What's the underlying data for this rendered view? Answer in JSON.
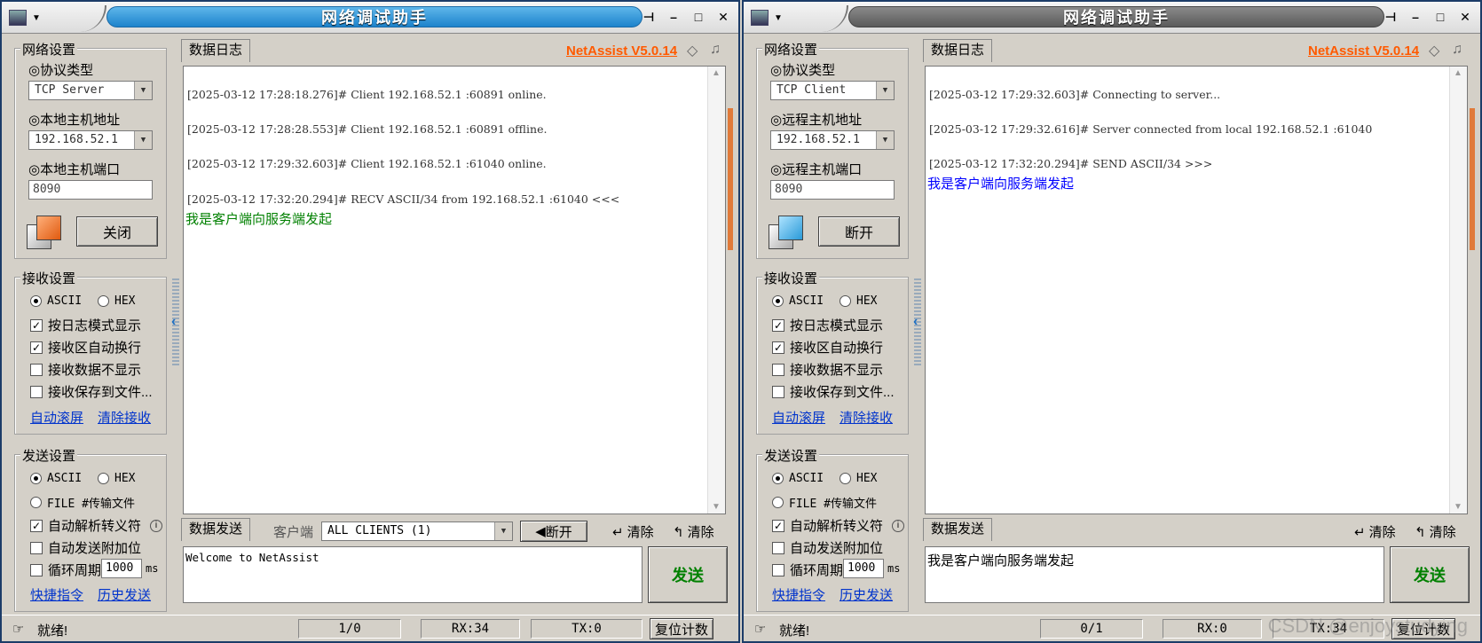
{
  "colors": {
    "active_title": "#1d83cc",
    "inactive_title": "#5a5a5a",
    "brand": "#ff5a00",
    "recv_text": "#008000",
    "send_text": "#0000ff",
    "link": "#0033cc"
  },
  "left": {
    "title": "网络调试助手",
    "network": {
      "group_title": "网络设置",
      "protocol_label": "◎协议类型",
      "protocol_value": "TCP Server",
      "host_label": "◎本地主机地址",
      "host_value": "192.168.52.1",
      "port_label": "◎本地主机端口",
      "port_value": "8090",
      "action_button": "关闭"
    },
    "recv": {
      "group_title": "接收设置",
      "ascii": "ASCII",
      "hex": "HEX",
      "opt_log_mode": "按日志模式显示",
      "opt_auto_wrap": "接收区自动换行",
      "opt_hide_data": "接收数据不显示",
      "opt_save_file": "接收保存到文件...",
      "link_autoscroll": "自动滚屏",
      "link_clear": "清除接收"
    },
    "send": {
      "group_title": "发送设置",
      "ascii": "ASCII",
      "hex": "HEX",
      "file_mode": "FILE #传输文件",
      "opt_escape": "自动解析转义符",
      "opt_append": "自动发送附加位",
      "opt_cycle": "循环周期",
      "cycle_value": "1000",
      "cycle_unit": "ms",
      "link_shortcuts": "快捷指令",
      "link_history": "历史发送"
    },
    "log": {
      "tab": "数据日志",
      "brand": "NetAssist V5.0.14",
      "entries": [
        {
          "header": "[2025-03-12 17:28:18.276]# Client 192.168.52.1 :60891 online.",
          "message": ""
        },
        {
          "header": "[2025-03-12 17:28:28.553]# Client 192.168.52.1 :60891 offline.",
          "message": ""
        },
        {
          "header": "[2025-03-12 17:29:32.603]# Client 192.168.52.1 :61040 online.",
          "message": ""
        },
        {
          "header": "[2025-03-12 17:32:20.294]# RECV ASCII/34 from 192.168.52.1 :61040 <<<",
          "message": "我是客户端向服务端发起"
        }
      ]
    },
    "sendbar": {
      "tab": "数据发送",
      "client_label": "客户端",
      "client_value": "ALL CLIENTS (1)",
      "disconnect": "断开",
      "clear1": "清除",
      "clear2": "清除",
      "input_text": "Welcome to NetAssist",
      "send_button": "发送"
    },
    "status": {
      "text": "就绪!",
      "count": "1/0",
      "rx": "RX:34",
      "tx": "TX:0",
      "reset": "复位计数"
    }
  },
  "right": {
    "title": "网络调试助手",
    "network": {
      "group_title": "网络设置",
      "protocol_label": "◎协议类型",
      "protocol_value": "TCP Client",
      "host_label": "◎远程主机地址",
      "host_value": "192.168.52.1",
      "port_label": "◎远程主机端口",
      "port_value": "8090",
      "action_button": "断开"
    },
    "recv": {
      "group_title": "接收设置",
      "ascii": "ASCII",
      "hex": "HEX",
      "opt_log_mode": "按日志模式显示",
      "opt_auto_wrap": "接收区自动换行",
      "opt_hide_data": "接收数据不显示",
      "opt_save_file": "接收保存到文件...",
      "link_autoscroll": "自动滚屏",
      "link_clear": "清除接收"
    },
    "send": {
      "group_title": "发送设置",
      "ascii": "ASCII",
      "hex": "HEX",
      "file_mode": "FILE #传输文件",
      "opt_escape": "自动解析转义符",
      "opt_append": "自动发送附加位",
      "opt_cycle": "循环周期",
      "cycle_value": "1000",
      "cycle_unit": "ms",
      "link_shortcuts": "快捷指令",
      "link_history": "历史发送"
    },
    "log": {
      "tab": "数据日志",
      "brand": "NetAssist V5.0.14",
      "entries": [
        {
          "header": "[2025-03-12 17:29:32.603]# Connecting to server...",
          "message": ""
        },
        {
          "header": "[2025-03-12 17:29:32.616]# Server connected from local 192.168.52.1 :61040",
          "message": ""
        },
        {
          "header": "[2025-03-12 17:32:20.294]# SEND ASCII/34 >>>",
          "message": "我是客户端向服务端发起"
        }
      ]
    },
    "sendbar": {
      "tab": "数据发送",
      "clear1": "清除",
      "clear2": "清除",
      "input_text": "我是客户端向服务端发起",
      "send_button": "发送"
    },
    "status": {
      "text": "就绪!",
      "count": "0/1",
      "rx": "RX:0",
      "tx": "TX:34",
      "reset": "复位计数"
    }
  },
  "watermark": "CSDN @enjoystudying"
}
